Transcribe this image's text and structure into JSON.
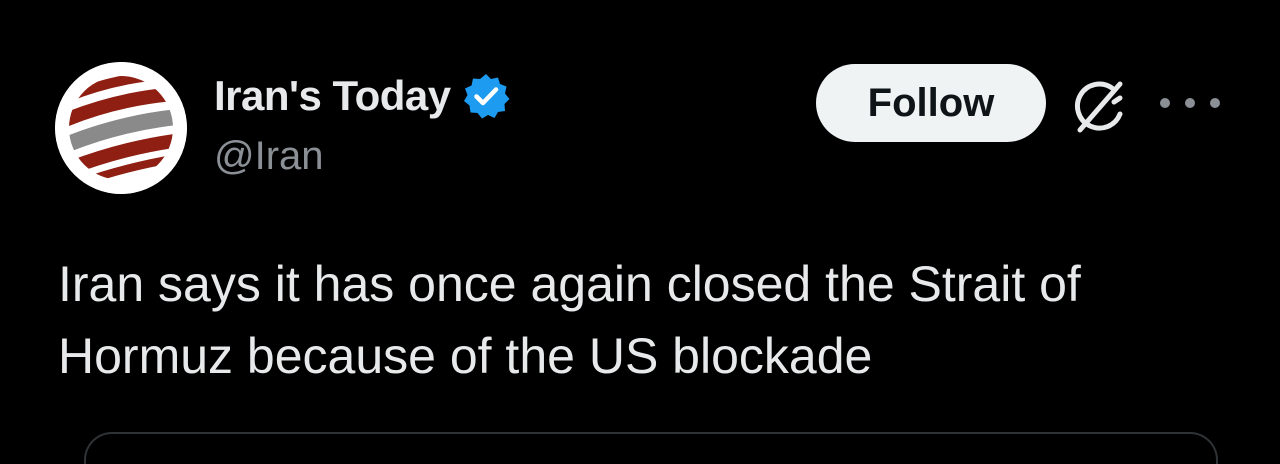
{
  "post": {
    "author": {
      "display_name": "Iran's Today",
      "handle": "@Iran",
      "verified": true,
      "avatar_icon": "striped-globe-logo"
    },
    "actions": {
      "follow_label": "Follow",
      "grok_icon": "grok-icon",
      "more_icon": "more-options-icon"
    },
    "text": "Iran says it has once again closed the Strait of Hormuz because of the US blockade"
  },
  "colors": {
    "background": "#000000",
    "text_primary": "#e7e9ea",
    "text_secondary": "#8b9096",
    "verified_blue": "#1d9bf0",
    "follow_bg": "#eff3f4",
    "logo_red": "#8f1f12",
    "logo_gray": "#8a8a8a"
  }
}
